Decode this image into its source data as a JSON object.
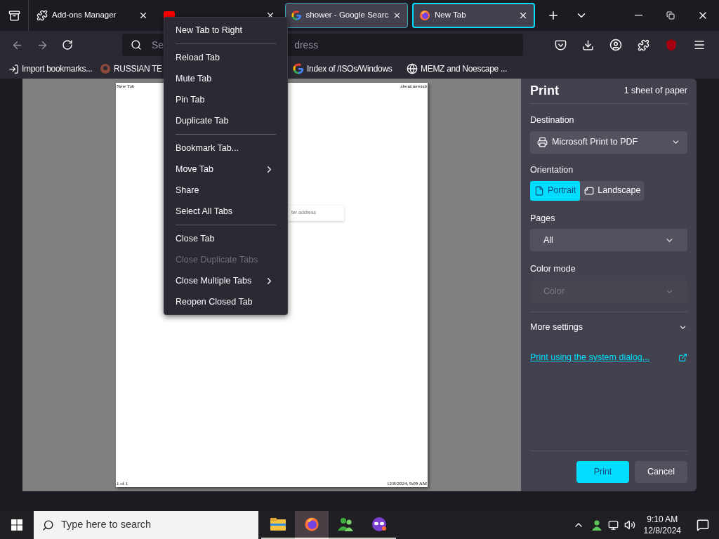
{
  "tab_strip": {
    "tabs": [
      {
        "title": "Add-ons Manager",
        "kind": "puzzle",
        "selected": false,
        "multiselected": false
      },
      {
        "kind": "video",
        "selected": false,
        "multiselected": false
      },
      {
        "title": "shower - Google Searc",
        "kind": "google",
        "selected": false,
        "multiselected": true
      },
      {
        "title": "New Tab",
        "kind": "firefox",
        "selected": true,
        "multiselected": true
      }
    ]
  },
  "toolbar": {
    "address_left": "Se",
    "address_right": "dress"
  },
  "bookmarks": [
    {
      "title": "Import bookmarks...",
      "kind": "import"
    },
    {
      "title": "RUSSIAN TE",
      "kind": "avatar"
    },
    {
      "title": "Index of /ISOs/Windows",
      "kind": "google"
    },
    {
      "title": "MEMZ and Noescape ...",
      "kind": "globe"
    }
  ],
  "preview": {
    "header_left": "New Tab",
    "header_right": "about:newtab",
    "fragment": "ter address",
    "footer_left": "1 of 1",
    "footer_right": "12/8/2024, 9:09 AM"
  },
  "print": {
    "title": "Print",
    "sheets": "1 sheet of paper",
    "destination_label": "Destination",
    "destination": "Microsoft Print to PDF",
    "orientation_label": "Orientation",
    "orientations": [
      {
        "label": "Portrait",
        "selected": true
      },
      {
        "label": "Landscape",
        "selected": false
      }
    ],
    "pages_label": "Pages",
    "pages": "All",
    "color_mode": {
      "label": "Color mode",
      "value": "Color",
      "disabled": true
    },
    "more_settings": "More settings",
    "system_dialog_link": "Print using the system dialog...",
    "buttons": [
      {
        "label": "Print",
        "kind": "primary"
      },
      {
        "label": "Cancel",
        "kind": "secondary"
      }
    ]
  },
  "context_menu": {
    "items": [
      {
        "kind": "item",
        "label": "New Tab to Right",
        "disabled": false,
        "submenu": false
      },
      {
        "kind": "separator"
      },
      {
        "kind": "item",
        "label": "Reload Tab",
        "disabled": false,
        "submenu": false
      },
      {
        "kind": "item",
        "label": "Mute Tab",
        "disabled": false,
        "submenu": false
      },
      {
        "kind": "item",
        "label": "Pin Tab",
        "disabled": false,
        "submenu": false
      },
      {
        "kind": "item",
        "label": "Duplicate Tab",
        "disabled": false,
        "submenu": false
      },
      {
        "kind": "separator"
      },
      {
        "kind": "item",
        "label": "Bookmark Tab...",
        "disabled": false,
        "submenu": false
      },
      {
        "kind": "item",
        "label": "Move Tab",
        "disabled": false,
        "submenu": true
      },
      {
        "kind": "item",
        "label": "Share",
        "disabled": false,
        "submenu": false
      },
      {
        "kind": "item",
        "label": "Select All Tabs",
        "disabled": false,
        "submenu": false
      },
      {
        "kind": "separator"
      },
      {
        "kind": "item",
        "label": "Close Tab",
        "disabled": false,
        "submenu": false
      },
      {
        "kind": "item",
        "label": "Close Duplicate Tabs",
        "disabled": true,
        "submenu": false
      },
      {
        "kind": "item",
        "label": "Close Multiple Tabs",
        "disabled": false,
        "submenu": true
      },
      {
        "kind": "item",
        "label": "Reopen Closed Tab",
        "disabled": false,
        "submenu": false
      }
    ]
  },
  "taskbar": {
    "search_placeholder": "Type here to search",
    "apps": [
      {
        "kind": "folder",
        "active": false
      },
      {
        "kind": "firefox",
        "active": true
      },
      {
        "kind": "people",
        "active": false
      },
      {
        "kind": "mask",
        "active": false
      }
    ],
    "time": "9:10 AM",
    "date": "12/8/2024"
  }
}
